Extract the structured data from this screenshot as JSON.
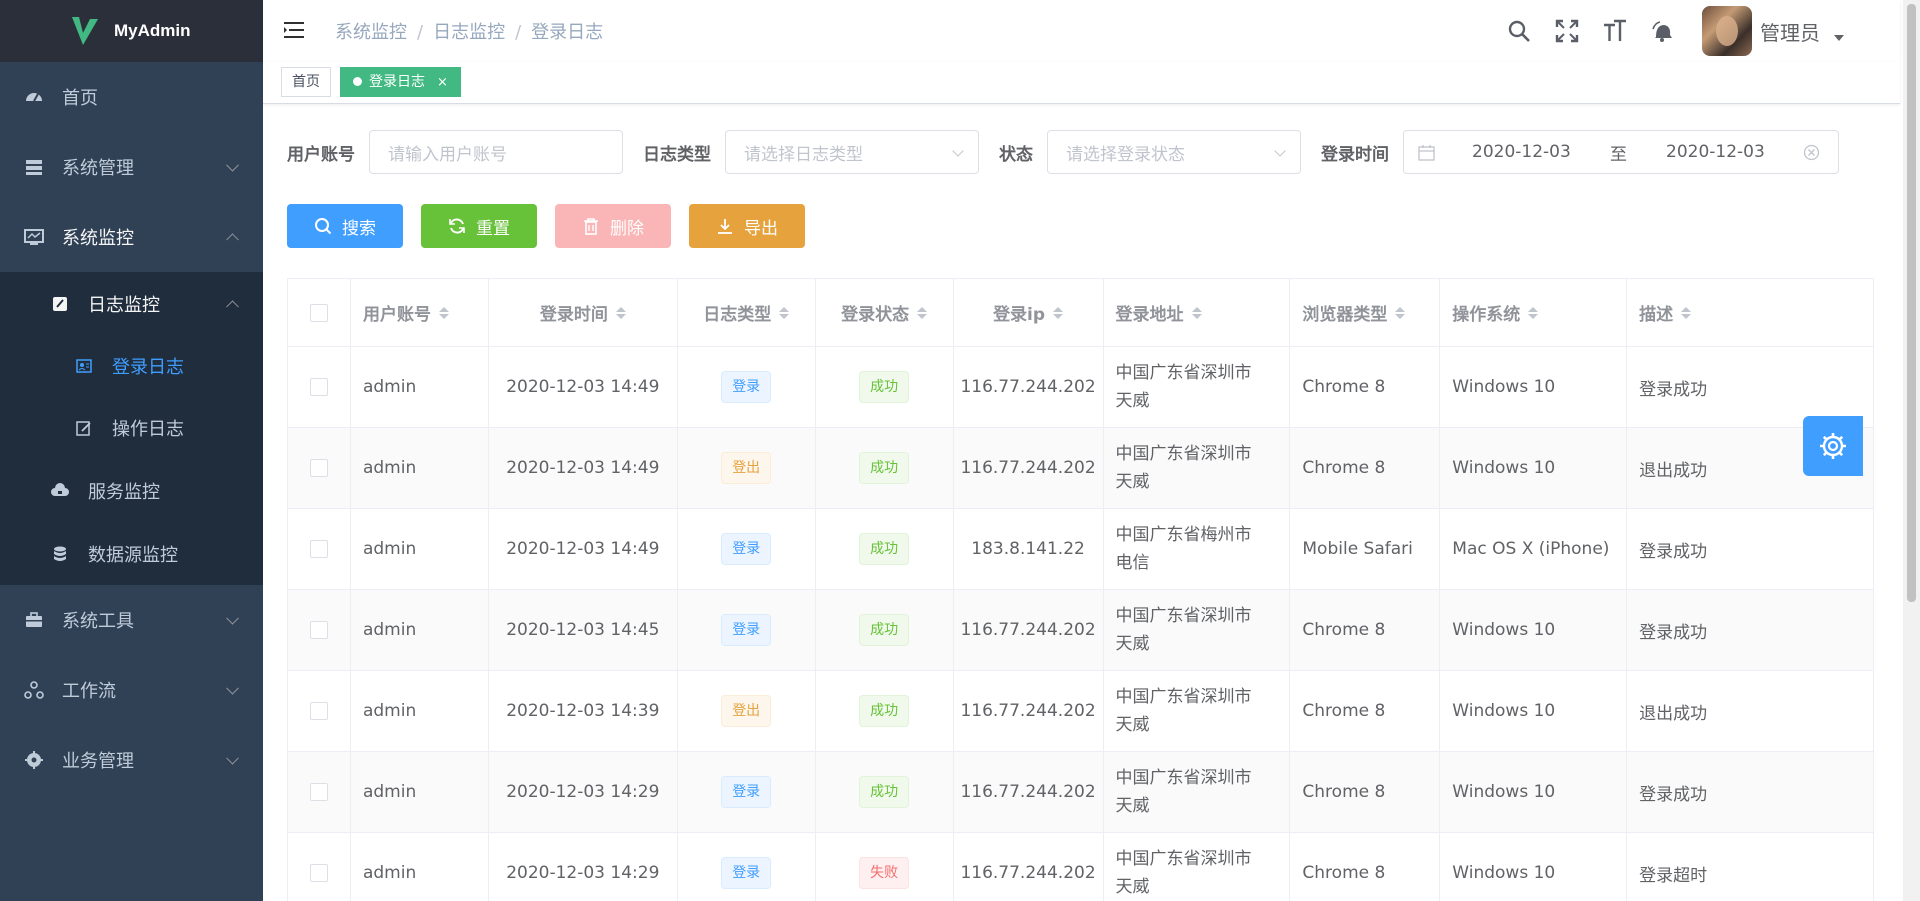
{
  "app": {
    "brand": "MyAdmin"
  },
  "colors": {
    "sidebar_bg": "#304156",
    "active": "#409eff",
    "tag_active": "#42b983"
  },
  "sidebar": {
    "items": [
      {
        "label": "首页",
        "icon": "dashboard-icon"
      },
      {
        "label": "系统管理",
        "icon": "system-icon"
      },
      {
        "label": "系统监控",
        "icon": "monitor-icon"
      },
      {
        "label": "系统工具",
        "icon": "tool-icon"
      },
      {
        "label": "工作流",
        "icon": "workflow-icon"
      },
      {
        "label": "业务管理",
        "icon": "business-icon"
      }
    ],
    "monitor_sub": [
      {
        "label": "日志监控",
        "icon": "log-icon"
      },
      {
        "label": "服务监控",
        "icon": "server-icon"
      },
      {
        "label": "数据源监控",
        "icon": "database-icon"
      }
    ],
    "log_sub": [
      {
        "label": "登录日志",
        "icon": "login-log-icon"
      },
      {
        "label": "操作日志",
        "icon": "operation-log-icon"
      }
    ]
  },
  "breadcrumb": [
    "系统监控",
    "日志监控",
    "登录日志"
  ],
  "header": {
    "username": "管理员"
  },
  "tags": {
    "home": "首页",
    "current": "登录日志",
    "close": "×"
  },
  "search": {
    "account_label": "用户账号",
    "account_placeholder": "请输入用户账号",
    "type_label": "日志类型",
    "type_placeholder": "请选择日志类型",
    "status_label": "状态",
    "status_placeholder": "请选择登录状态",
    "time_label": "登录时间",
    "date_start": "2020-12-03",
    "date_sep": "至",
    "date_end": "2020-12-03"
  },
  "buttons": {
    "search": "搜索",
    "reset": "重置",
    "delete": "删除",
    "export": "导出"
  },
  "table": {
    "columns": [
      "用户账号",
      "登录时间",
      "日志类型",
      "登录状态",
      "登录ip",
      "登录地址",
      "浏览器类型",
      "操作系统",
      "描述"
    ],
    "rows": [
      {
        "account": "admin",
        "time": "2020-12-03 14:49",
        "type": "登录",
        "type_kind": "primary",
        "status": "成功",
        "status_kind": "success",
        "ip": "116.77.244.202",
        "addr1": "中国广东省深圳市",
        "addr2": "天威",
        "browser": "Chrome 8",
        "os": "Windows 10",
        "desc": "登录成功"
      },
      {
        "account": "admin",
        "time": "2020-12-03 14:49",
        "type": "登出",
        "type_kind": "warning",
        "status": "成功",
        "status_kind": "success",
        "ip": "116.77.244.202",
        "addr1": "中国广东省深圳市",
        "addr2": "天威",
        "browser": "Chrome 8",
        "os": "Windows 10",
        "desc": "退出成功"
      },
      {
        "account": "admin",
        "time": "2020-12-03 14:49",
        "type": "登录",
        "type_kind": "primary",
        "status": "成功",
        "status_kind": "success",
        "ip": "183.8.141.22",
        "addr1": "中国广东省梅州市",
        "addr2": "电信",
        "browser": "Mobile Safari",
        "os": "Mac OS X (iPhone)",
        "desc": "登录成功"
      },
      {
        "account": "admin",
        "time": "2020-12-03 14:45",
        "type": "登录",
        "type_kind": "primary",
        "status": "成功",
        "status_kind": "success",
        "ip": "116.77.244.202",
        "addr1": "中国广东省深圳市",
        "addr2": "天威",
        "browser": "Chrome 8",
        "os": "Windows 10",
        "desc": "登录成功"
      },
      {
        "account": "admin",
        "time": "2020-12-03 14:39",
        "type": "登出",
        "type_kind": "warning",
        "status": "成功",
        "status_kind": "success",
        "ip": "116.77.244.202",
        "addr1": "中国广东省深圳市",
        "addr2": "天威",
        "browser": "Chrome 8",
        "os": "Windows 10",
        "desc": "退出成功"
      },
      {
        "account": "admin",
        "time": "2020-12-03 14:29",
        "type": "登录",
        "type_kind": "primary",
        "status": "成功",
        "status_kind": "success",
        "ip": "116.77.244.202",
        "addr1": "中国广东省深圳市",
        "addr2": "天威",
        "browser": "Chrome 8",
        "os": "Windows 10",
        "desc": "登录成功"
      },
      {
        "account": "admin",
        "time": "2020-12-03 14:29",
        "type": "登录",
        "type_kind": "primary",
        "status": "失败",
        "status_kind": "danger",
        "ip": "116.77.244.202",
        "addr1": "中国广东省深圳市",
        "addr2": "天威",
        "browser": "Chrome 8",
        "os": "Windows 10",
        "desc": "登录超时"
      }
    ]
  }
}
